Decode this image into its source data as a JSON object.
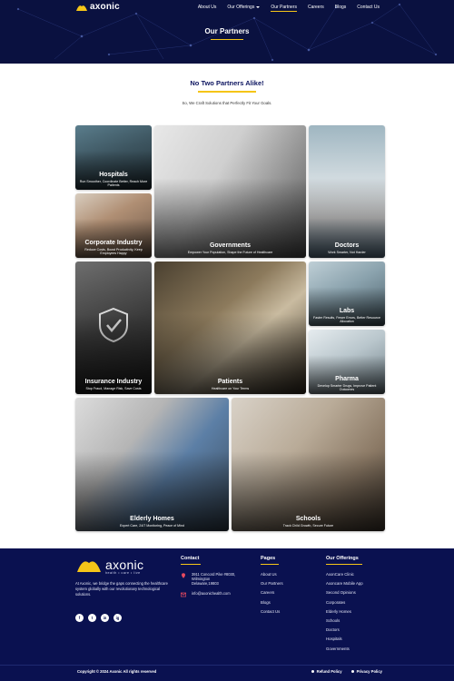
{
  "nav": {
    "brand": "axonic",
    "items": [
      {
        "label": "About Us"
      },
      {
        "label": "Our Offerings"
      },
      {
        "label": "Our Partners"
      },
      {
        "label": "Careers"
      },
      {
        "label": "Blogs"
      },
      {
        "label": "Contact Us"
      }
    ]
  },
  "hero": {
    "title": "Our Partners"
  },
  "intro": {
    "title": "No Two Partners Alike!",
    "subtitle": "So, We Craft Solutions that Perfectly Fit Your Goals."
  },
  "partners": [
    {
      "title": "Hospitals",
      "desc": "Run Smoother, Coordinate Better, Reach More Patients"
    },
    {
      "title": "Corporate Industry",
      "desc": "Reduce Costs, Boost Productivity, Keep Employees Happy"
    },
    {
      "title": "Governments",
      "desc": "Empower Your Population, Shape the Future of Healthcare"
    },
    {
      "title": "Doctors",
      "desc": "Work Smarter, Not Harder"
    },
    {
      "title": "Insurance Industry",
      "desc": "Stop Fraud, Manage Risk, Save Costs"
    },
    {
      "title": "Patients",
      "desc": "Healthcare on Your Terms"
    },
    {
      "title": "Labs",
      "desc": "Faster Results, Fewer Errors, Better Resource Allocation"
    },
    {
      "title": "Pharma",
      "desc": "Develop Smarter Drugs, Improve Patient Outcomes"
    },
    {
      "title": "Elderly Homes",
      "desc": "Expert Care, 24/7 Monitoring, Peace of Mind"
    },
    {
      "title": "Schools",
      "desc": "Track Child Growth, Secure Future"
    }
  ],
  "footer": {
    "brand": "axonic",
    "tagline": "health • care • live",
    "about": "At Axonic, we bridge the gaps connecting the healthcare system globally with our revolutionary technological solutions.",
    "socials": [
      "f",
      "t",
      "in",
      "ig"
    ],
    "contact": {
      "heading": "Contact",
      "address": "3911 Concord Pike #8030, Wilmington Delaware,19803",
      "email": "info@axonichealth.com"
    },
    "pages": {
      "heading": "Pages",
      "items": [
        "About Us",
        "Our Partners",
        "Careers",
        "Blogs",
        "Contact Us"
      ]
    },
    "offerings": {
      "heading": "Our Offerings",
      "items": [
        "AxonCare Clinic",
        "Axoncare Mobile App",
        "Second Opinions",
        "Corporates",
        "Elderly Homes",
        "Schools",
        "Doctors",
        "Hospitals",
        "Governments"
      ]
    },
    "copyright": "Copyright © 2024 Axonic All rights reserved",
    "legal": [
      "Refund Policy",
      "Privacy Policy"
    ]
  },
  "colors": {
    "navy": "#0a1150",
    "accent": "#f5c518"
  }
}
